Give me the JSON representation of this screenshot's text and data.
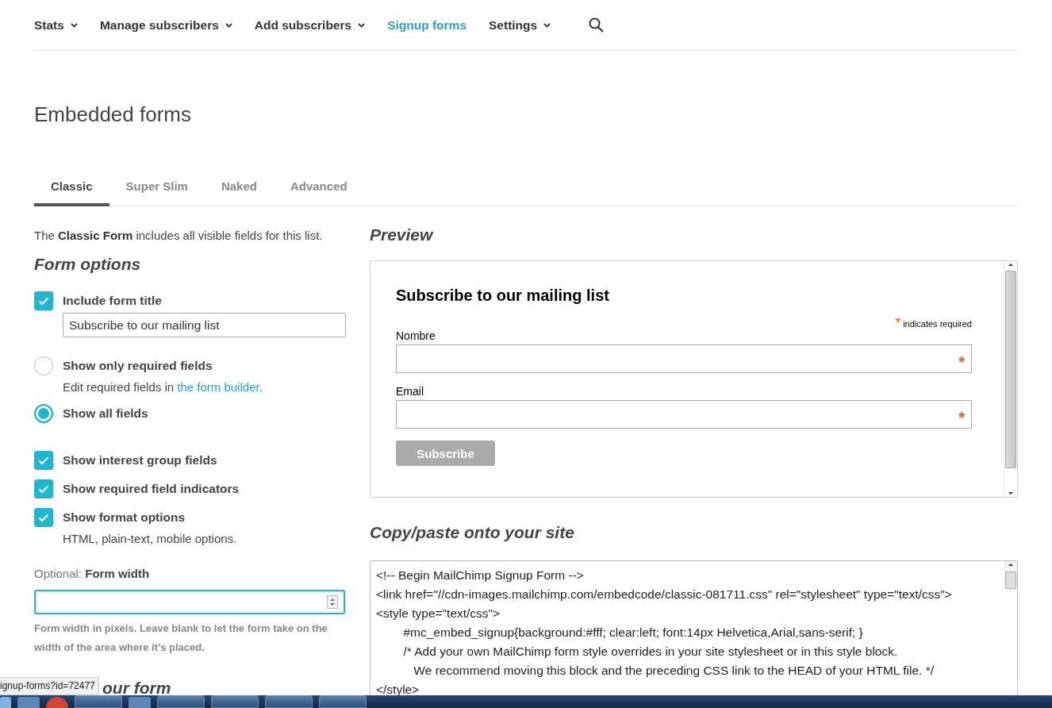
{
  "nav": {
    "items": [
      {
        "label": "Stats",
        "selected": false,
        "dropdown": true
      },
      {
        "label": "Manage subscribers",
        "selected": false,
        "dropdown": true
      },
      {
        "label": "Add subscribers",
        "selected": false,
        "dropdown": true
      },
      {
        "label": "Signup forms",
        "selected": true,
        "dropdown": false
      },
      {
        "label": "Settings",
        "selected": false,
        "dropdown": true
      }
    ]
  },
  "page_title": "Embedded forms",
  "tabs": [
    {
      "label": "Classic",
      "selected": true
    },
    {
      "label": "Super Slim",
      "selected": false
    },
    {
      "label": "Naked",
      "selected": false
    },
    {
      "label": "Advanced",
      "selected": false
    }
  ],
  "intro": "The **Classic Form** includes all visible fields for this list.",
  "form_options": {
    "heading": "Form options",
    "options": [
      {
        "kind": "checkbox",
        "label": "Include form title",
        "checked": true,
        "field_value": "Subscribe to our mailing list"
      },
      {
        "kind": "radio",
        "label": "Show only required fields",
        "selected": false,
        "note": "Edit required fields in ",
        "link": "the form builder",
        "note_end": "."
      },
      {
        "kind": "radio",
        "label": "Show all fields",
        "selected": true
      },
      {
        "kind": "checkbox",
        "label": "Show interest group fields",
        "checked": true
      },
      {
        "kind": "checkbox",
        "label": "Show required field indicators",
        "checked": true
      },
      {
        "kind": "checkbox",
        "label": "Show format options",
        "checked": true,
        "note": "HTML, plain-text, mobile options."
      }
    ],
    "width_prefix": "Optional:",
    "width_label": "Form width",
    "width_help": "Form width in pixels. Leave blank to let the form take on the width of the area where it’s placed."
  },
  "next_heading": "our form",
  "preview": {
    "heading": "Preview",
    "title": "Subscribe to our mailing list",
    "required_mark": "*",
    "required_note": "indicates required",
    "fields": [
      {
        "label": "Nombre",
        "mark": "*"
      },
      {
        "label": "Email",
        "mark": "*"
      }
    ],
    "button": "Subscribe"
  },
  "code": {
    "heading": "Copy/paste onto your site",
    "lines": [
      "<!-- Begin MailChimp Signup Form -->",
      "<link href=\"//cdn-images.mailchimp.com/embedcode/classic-081711.css\" rel=\"stylesheet\" type=\"text/css\">",
      "<style type=\"text/css\">",
      "        #mc_embed_signup{background:#fff; clear:left; font:14px Helvetica,Arial,sans-serif; }",
      "        /* Add your own MailChimp form style overrides in your site stylesheet or in this style block.",
      "           We recommend moving this block and the preceding CSS link to the HEAD of your HTML file. */",
      "</style>"
    ]
  },
  "status_url": "ignup-forms?id=72477"
}
